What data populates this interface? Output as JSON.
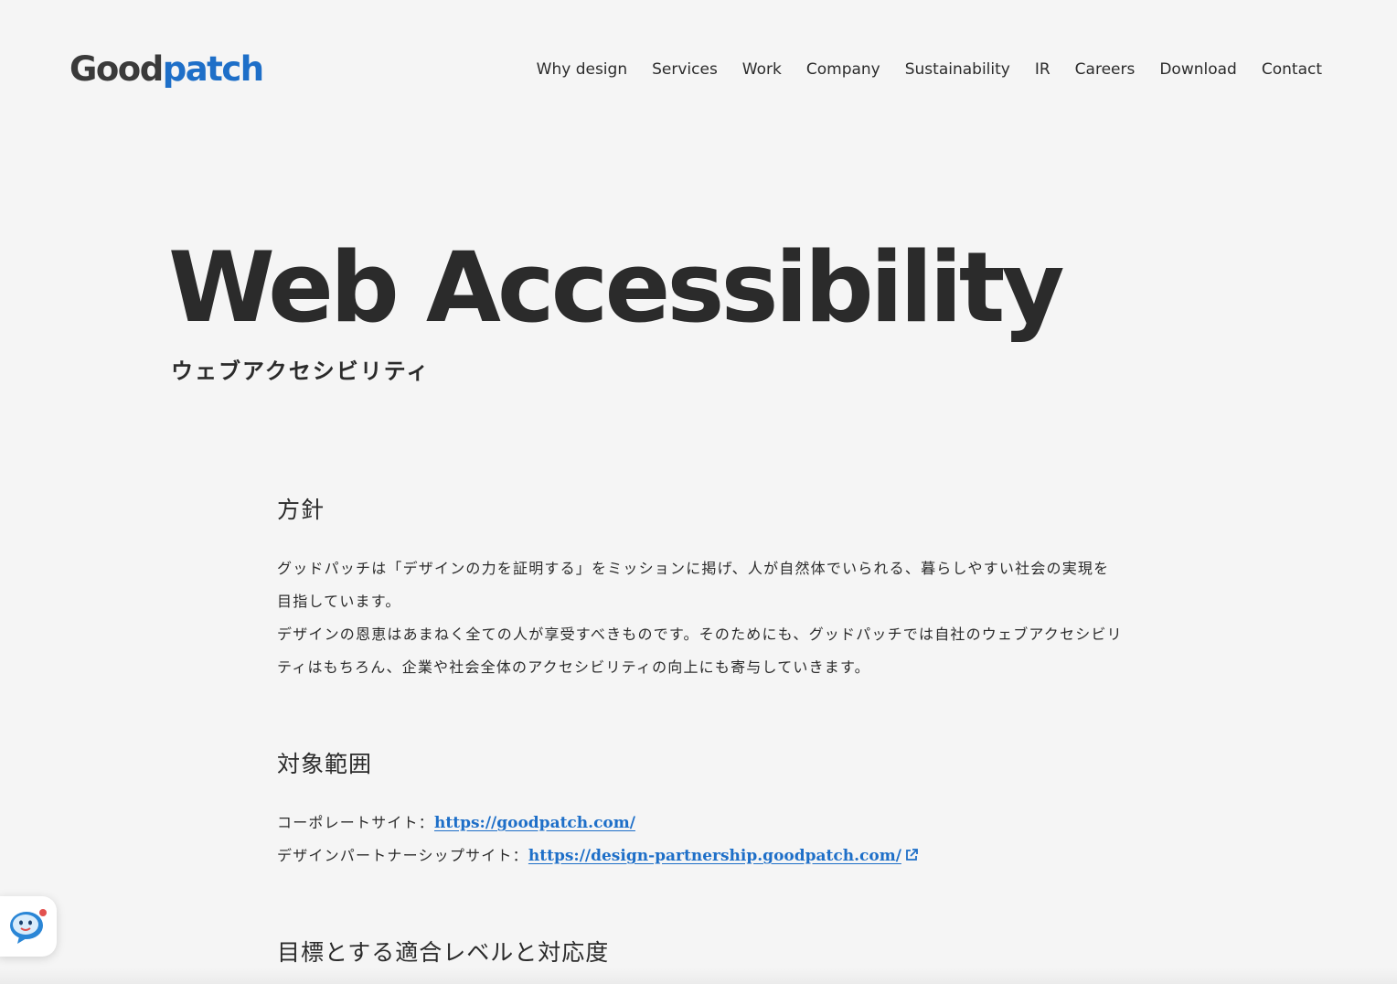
{
  "header": {
    "logo": {
      "part1": "Good",
      "part2": "patch"
    },
    "nav": [
      "Why design",
      "Services",
      "Work",
      "Company",
      "Sustainability",
      "IR",
      "Careers",
      "Download",
      "Contact"
    ]
  },
  "hero": {
    "title": "Web Accessibility",
    "subtitle": "ウェブアクセシビリティ"
  },
  "policy": {
    "heading": "方針",
    "paragraph1": "グッドパッチは「デザインの力を証明する」をミッションに掲げ、人が自然体でいられる、暮らしやすい社会の実現を目指しています。",
    "paragraph2": "デザインの恩恵はあまねく全ての人が享受すべきものです。そのためにも、グッドパッチでは自社のウェブアクセシビリティはもちろん、企業や社会全体のアクセシビリティの向上にも寄与していきます。"
  },
  "scope": {
    "heading": "対象範囲",
    "corporate_label": "コーポレートサイト：",
    "corporate_url": "https://goodpatch.com/",
    "partnership_label": "デザインパートナーシップサイト：",
    "partnership_url": "https://design-partnership.goodpatch.com/"
  },
  "level": {
    "heading": "目標とする適合レベルと対応度"
  },
  "colors": {
    "background": "#f5f5f5",
    "text": "#2b2b2b",
    "brand_blue": "#1e6fc8"
  },
  "icons": {
    "external_link": "external-link-icon",
    "chat": "chat-bot-icon"
  }
}
